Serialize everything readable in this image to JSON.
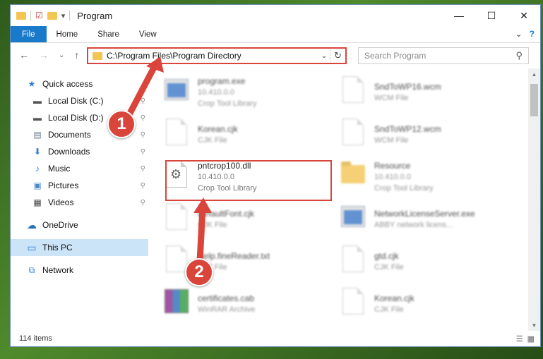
{
  "window": {
    "title": "Program",
    "controls": {
      "minimize": "—",
      "maximize": "☐",
      "close": "✕"
    }
  },
  "ribbon": {
    "tabs": [
      "File",
      "Home",
      "Share",
      "View"
    ],
    "expand_glyph": "⌄",
    "help_glyph": "?"
  },
  "address": {
    "path": "C:\\Program Files\\Program Directory",
    "dropdown_glyph": "⌄",
    "refresh_glyph": "↻"
  },
  "search": {
    "placeholder": "Search Program",
    "icon_glyph": "⚲"
  },
  "nav": {
    "back": "←",
    "forward": "→",
    "recent": "⌄",
    "up": "↑"
  },
  "sidebar": {
    "items": [
      {
        "label": "Quick access",
        "icon": "star-icon",
        "glyph": "★",
        "color": "#2b7cd3",
        "pinned": false
      },
      {
        "label": "Local Disk (C:)",
        "icon": "drive-icon",
        "glyph": "▬",
        "color": "#555555",
        "pinned": true
      },
      {
        "label": "Local Disk (D:)",
        "icon": "drive-icon",
        "glyph": "▬",
        "color": "#555555",
        "pinned": true
      },
      {
        "label": "Documents",
        "icon": "documents-icon",
        "glyph": "▤",
        "color": "#6a7b8c",
        "pinned": true
      },
      {
        "label": "Downloads",
        "icon": "download-icon",
        "glyph": "⬇",
        "color": "#2b7cd3",
        "pinned": true
      },
      {
        "label": "Music",
        "icon": "music-icon",
        "glyph": "♪",
        "color": "#2b7cd3",
        "pinned": true
      },
      {
        "label": "Pictures",
        "icon": "pictures-icon",
        "glyph": "▣",
        "color": "#4a8ac8",
        "pinned": true
      },
      {
        "label": "Videos",
        "icon": "videos-icon",
        "glyph": "▦",
        "color": "#444444",
        "pinned": true
      }
    ],
    "onedrive": {
      "label": "OneDrive",
      "glyph": "☁",
      "color": "#1e6fbf"
    },
    "thispc": {
      "label": "This PC",
      "glyph": "▭",
      "color": "#2b7cd3"
    },
    "network": {
      "label": "Network",
      "glyph": "⧉",
      "color": "#2b7cd3"
    },
    "pin_glyph": "✎"
  },
  "files": [
    {
      "name": "program.exe",
      "line2": "10.410.0.0",
      "line3": "Crop Tool Library",
      "kind": "exe"
    },
    {
      "name": "SndToWP16.wcm",
      "line2": "WCM File",
      "line3": "",
      "kind": "doc"
    },
    {
      "name": "Korean.cjk",
      "line2": "CJK File",
      "line3": "",
      "kind": "doc"
    },
    {
      "name": "SndToWP12.wcm",
      "line2": "WCM File",
      "line3": "",
      "kind": "doc"
    },
    {
      "name": "pntcrop100.dll",
      "line2": "10.410.0.0",
      "line3": "Crop Tool Library",
      "kind": "dll"
    },
    {
      "name": "Resource",
      "line2": "10.410.0.0",
      "line3": "Crop Tool Library",
      "kind": "folder"
    },
    {
      "name": "DefaultFont.cjk",
      "line2": "CJK File",
      "line3": "",
      "kind": "doc"
    },
    {
      "name": "NetworkLicenseServer.exe",
      "line2": "ABBY network licens...",
      "line3": "",
      "kind": "exe"
    },
    {
      "name": "Help.fineReader.txt",
      "line2": "TXT File",
      "line3": "",
      "kind": "doc"
    },
    {
      "name": "gtd.cjk",
      "line2": "CJK File",
      "line3": "",
      "kind": "doc"
    },
    {
      "name": "certificates.cab",
      "line2": "WinRAR Archive",
      "line3": "",
      "kind": "rar"
    },
    {
      "name": "Korean.cjk",
      "line2": "CJK File",
      "line3": "",
      "kind": "doc"
    }
  ],
  "status": {
    "count": "114 items"
  },
  "callouts": [
    "1",
    "2"
  ],
  "colors": {
    "accent": "#1979ca",
    "highlight": "#d9453b"
  }
}
